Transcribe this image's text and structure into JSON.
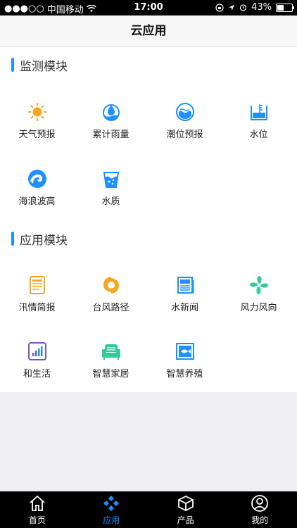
{
  "status_bar": {
    "signal": "●●●○○",
    "carrier": "中国移动",
    "time": "17:00",
    "battery_percent": "43%",
    "battery_level": 0.43
  },
  "nav": {
    "title": "云应用"
  },
  "monitoring": {
    "title": "监测模块",
    "items": [
      {
        "label": "天气预报",
        "icon": "sun-icon"
      },
      {
        "label": "累计雨量",
        "icon": "rain-gauge-icon"
      },
      {
        "label": "潮位预报",
        "icon": "tide-icon"
      },
      {
        "label": "水位",
        "icon": "water-level-icon"
      },
      {
        "label": "海浪波高",
        "icon": "wave-icon"
      },
      {
        "label": "水质",
        "icon": "water-quality-icon"
      }
    ]
  },
  "apps": {
    "title": "应用模块",
    "items": [
      {
        "label": "汛情简报",
        "icon": "report-icon"
      },
      {
        "label": "台风路径",
        "icon": "typhoon-icon"
      },
      {
        "label": "水新闻",
        "icon": "news-icon"
      },
      {
        "label": "风力风向",
        "icon": "fan-icon"
      },
      {
        "label": "和生活",
        "icon": "signal-bars-icon"
      },
      {
        "label": "智慧家居",
        "icon": "sofa-icon"
      },
      {
        "label": "智慧养殖",
        "icon": "fish-icon"
      }
    ]
  },
  "tabs": [
    {
      "label": "首页",
      "icon": "home-icon",
      "active": false
    },
    {
      "label": "应用",
      "icon": "apps-icon",
      "active": true
    },
    {
      "label": "产品",
      "icon": "box-icon",
      "active": false
    },
    {
      "label": "我的",
      "icon": "user-icon",
      "active": false
    }
  ],
  "colors": {
    "accent": "#1e90ff",
    "sun": "#f5a623",
    "green": "#2ecc9a"
  }
}
